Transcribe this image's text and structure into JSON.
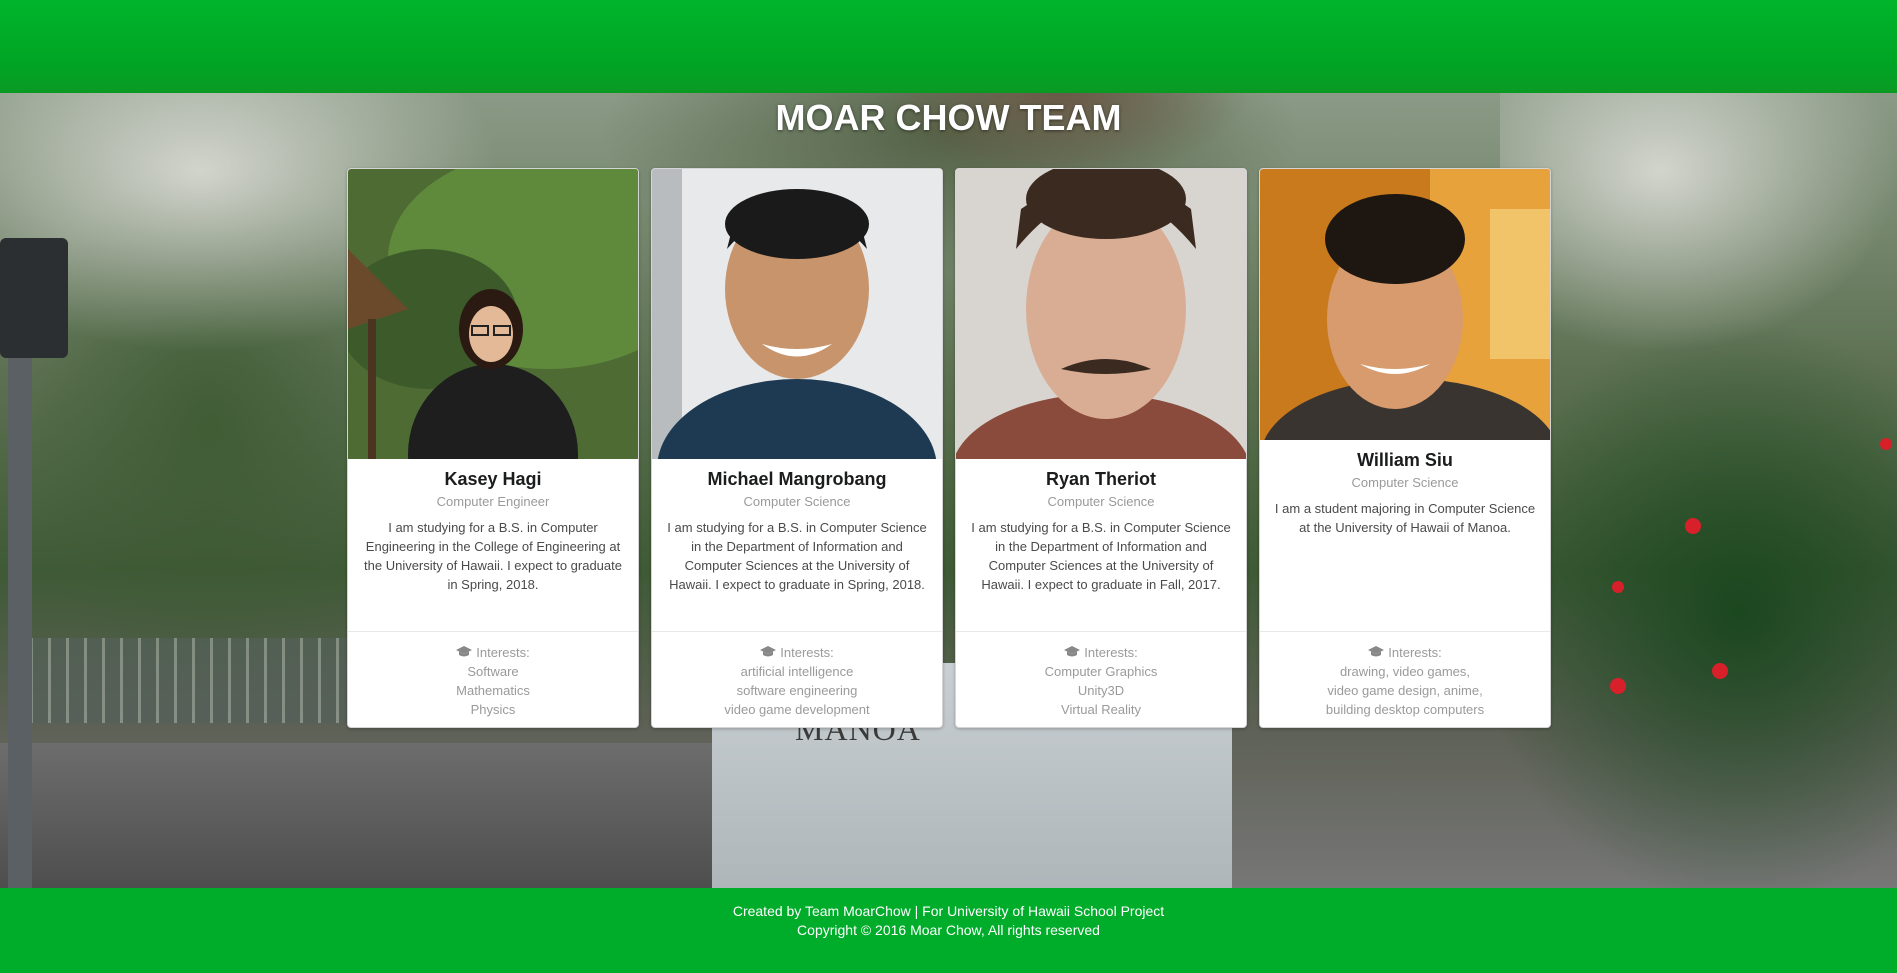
{
  "page_title": "MOAR CHOW TEAM",
  "members": [
    {
      "name": "Kasey Hagi",
      "role": "Computer Engineer",
      "description": "I am studying for a B.S. in Computer Engineering in the College of Engineering at the University of Hawaii. I expect to graduate in Spring, 2018.",
      "interests_label": "Interests:",
      "interests": [
        "Software",
        "Mathematics",
        "Physics"
      ]
    },
    {
      "name": "Michael Mangrobang",
      "role": "Computer Science",
      "description": "I am studying for a B.S. in Computer Science in the Department of Information and Computer Sciences at the University of Hawaii. I expect to graduate in Spring, 2018.",
      "interests_label": "Interests:",
      "interests": [
        "artificial intelligence",
        "software engineering",
        "video game development"
      ]
    },
    {
      "name": "Ryan Theriot",
      "role": "Computer Science",
      "description": "I am studying for a B.S. in Computer Science in the Department of Information and Computer Sciences at the University of Hawaii. I expect to graduate in Fall, 2017.",
      "interests_label": "Interests:",
      "interests": [
        "Computer Graphics",
        "Unity3D",
        "Virtual Reality"
      ]
    },
    {
      "name": "William Siu",
      "role": "Computer Science",
      "description": "I am a student majoring in Computer Science at the University of Hawaii of Manoa.",
      "interests_label": "Interests:",
      "interests": [
        "drawing, video games,",
        "video game design, anime,",
        "building desktop computers"
      ]
    }
  ],
  "background_sign_text": "MANOA",
  "footer": {
    "line1": "Created by Team MoarChow | For University of Hawaii School Project",
    "line2": "Copyright © 2016 Moar Chow, All rights reserved"
  },
  "colors": {
    "header_green": "#00a425",
    "footer_green": "#00ad2a",
    "card_bg": "#ffffff"
  }
}
